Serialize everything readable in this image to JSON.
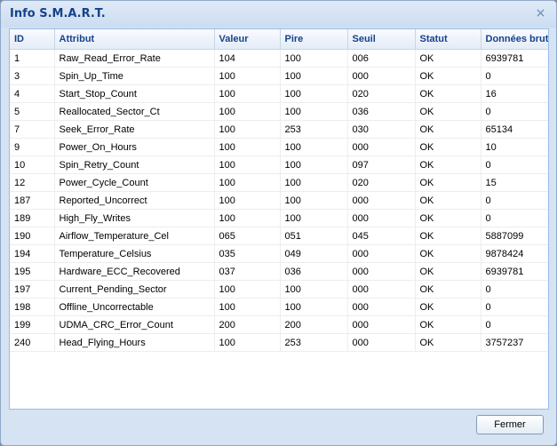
{
  "dialog": {
    "title": "Info S.M.A.R.T.",
    "close_glyph": "×",
    "close_icon": "close-icon",
    "close_button_label": "Fermer"
  },
  "table": {
    "columns": [
      "ID",
      "Attribut",
      "Valeur",
      "Pire",
      "Seuil",
      "Statut",
      "Données brutes"
    ],
    "rows": [
      [
        "1",
        "Raw_Read_Error_Rate",
        "104",
        "100",
        "006",
        "OK",
        "6939781"
      ],
      [
        "3",
        "Spin_Up_Time",
        "100",
        "100",
        "000",
        "OK",
        "0"
      ],
      [
        "4",
        "Start_Stop_Count",
        "100",
        "100",
        "020",
        "OK",
        "16"
      ],
      [
        "5",
        "Reallocated_Sector_Ct",
        "100",
        "100",
        "036",
        "OK",
        "0"
      ],
      [
        "7",
        "Seek_Error_Rate",
        "100",
        "253",
        "030",
        "OK",
        "65134"
      ],
      [
        "9",
        "Power_On_Hours",
        "100",
        "100",
        "000",
        "OK",
        "10"
      ],
      [
        "10",
        "Spin_Retry_Count",
        "100",
        "100",
        "097",
        "OK",
        "0"
      ],
      [
        "12",
        "Power_Cycle_Count",
        "100",
        "100",
        "020",
        "OK",
        "15"
      ],
      [
        "187",
        "Reported_Uncorrect",
        "100",
        "100",
        "000",
        "OK",
        "0"
      ],
      [
        "189",
        "High_Fly_Writes",
        "100",
        "100",
        "000",
        "OK",
        "0"
      ],
      [
        "190",
        "Airflow_Temperature_Cel",
        "065",
        "051",
        "045",
        "OK",
        "5887099"
      ],
      [
        "194",
        "Temperature_Celsius",
        "035",
        "049",
        "000",
        "OK",
        "9878424"
      ],
      [
        "195",
        "Hardware_ECC_Recovered",
        "037",
        "036",
        "000",
        "OK",
        "6939781"
      ],
      [
        "197",
        "Current_Pending_Sector",
        "100",
        "100",
        "000",
        "OK",
        "0"
      ],
      [
        "198",
        "Offline_Uncorrectable",
        "100",
        "100",
        "000",
        "OK",
        "0"
      ],
      [
        "199",
        "UDMA_CRC_Error_Count",
        "200",
        "200",
        "000",
        "OK",
        "0"
      ],
      [
        "240",
        "Head_Flying_Hours",
        "100",
        "253",
        "000",
        "OK",
        "3757237"
      ]
    ]
  }
}
